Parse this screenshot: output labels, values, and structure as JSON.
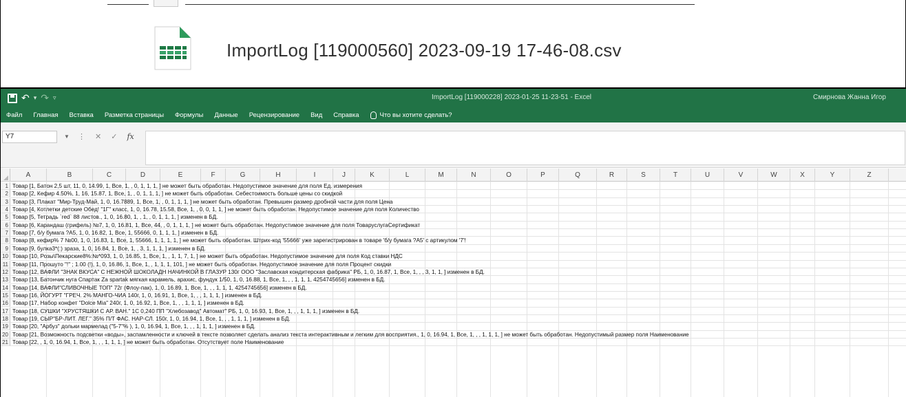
{
  "file_preview": {
    "file_name": "ImportLog [119000560] 2023-09-19 17-46-08.csv"
  },
  "excel": {
    "window_title": "ImportLog [119000228] 2023-01-25 11-23-51  -  Excel",
    "user_name": "Смирнова Жанна Игор",
    "ribbon_tabs": [
      "Файл",
      "Главная",
      "Вставка",
      "Разметка страницы",
      "Формулы",
      "Данные",
      "Рецензирование",
      "Вид",
      "Справка"
    ],
    "tell_me": "Что вы хотите сделать?",
    "name_box": "Y7",
    "formula_value": "",
    "columns": [
      "A",
      "B",
      "C",
      "D",
      "E",
      "F",
      "G",
      "H",
      "I",
      "J",
      "K",
      "L",
      "M",
      "N",
      "O",
      "P",
      "Q",
      "R",
      "S",
      "T",
      "U",
      "V",
      "W",
      "X",
      "Y",
      "Z"
    ],
    "rows": [
      {
        "n": "1",
        "text": "Товар [1, Батон 2,5 шт, 11, 0, 14.99, 1, Все, 1, , 0, 1, 1, 1, ] не может быть обработан. Недопустимое значение для поля Ед. измерения"
      },
      {
        "n": "2",
        "text": "Товар [2, Кефир 4.50%, 1, 16, 15.87, 1, Все, 1, , 0, 1, 1, 1, ] не может быть обработан. Себестоимость больше цены со скидкой"
      },
      {
        "n": "3",
        "text": "Товар [3, Плакат \"Мир-Труд-Май, 1, 0, 16.7889, 1, Все, 1, , 0, 1, 1, 1, ] не может быть обработан. Превышен размер дробной части для поля Цена"
      },
      {
        "n": "4",
        "text": "Товар [4, Котлетки детские Обед! \"1Г\" класс, 1, 0, 16.78, 15.58, Все, 1, , 0, 0, 1, 1, ] не может быть обработан. Недопустимое значение для поля Количество"
      },
      {
        "n": "5",
        "text": "Товар [5, Тетрадь `red` 88 листов., 1, 0, 16.80, 1, , 1, , 0, 1, 1, 1, ] изменен в БД."
      },
      {
        "n": "6",
        "text": "Товар [6, Карандаш (грифель) №7, 1, 0, 16.81, 1, Все, 44, , 0, 1, 1, 1, ] не может быть обработан. Недопустимое значение для поля ТоваруслугаСертификат"
      },
      {
        "n": "7",
        "text": "Товар [7, б/у бумага ?А5, 1, 0, 16.82, 1, Все, 1, 55666, 0, 1, 1, 1, ] изменен в БД."
      },
      {
        "n": "8",
        "text": "Товар [8, кефир% 7 №00, 1, 0, 16.83, 1, Все, 1, 55666, 1, 1, 1, 1, ] не может быть обработан. Штрих-код '55666' уже зарегистрирован в товаре 'б/у бумага ?А5' с артикулом '7'!"
      },
      {
        "n": "9",
        "text": "Товар [9, булка3*(:) зраза, 1, 0, 16.84, 1, Все, 1, , 3, 1, 1, 1, ] изменен в БД."
      },
      {
        "n": "10",
        "text": "Товар [10, Розы\\Пекарские8%:№*093, 1, 0, 16.85, 1, Все, 1, , 1, 1, 7, 1, ] не может быть обработан. Недопустимое значение для поля Код ставки НДС"
      },
      {
        "n": "11",
        "text": "Товар [11, Прошуто \"!\" ; 1.00 (!), 1, 0, 16.86, 1, Все, 1, , 1, 1, 1, 101, ] не может быть обработан. Недопустимое значение для поля Процент скидки"
      },
      {
        "n": "12",
        "text": "Товар [12, ВАФЛИ \"ЗНАК ВКУСА\" С НЕЖНОЙ ШОКОЛАДН НАЧИНКОЙ В ГЛАЗУР 130г ООО \"Заславская кондитерская фабрика\" РБ, 1, 0, 16.87, 1, Все, 1, , , 3, 1, 1, ] изменен в БД."
      },
      {
        "n": "13",
        "text": "Товар [13, Батончик нуга Спартак Za spartak мягкая карамель, арахис, фундук 1/50, 1, 0, 16.88, 1, Все, 1, , , 1, 1, 1, 4254745656] изменен в БД."
      },
      {
        "n": "14",
        "text": "Товар [14, ВАФЛИ\"СЛИВОЧНЫЕ ТОП\" 72г (Флоу-пак), 1, 0, 16.89, 1, Все, 1, , , 1, 1, 1, 4254745656] изменен в БД."
      },
      {
        "n": "15",
        "text": "Товар [16, ЙОГУРТ \"ГРЕЧ. 2% МАНГО-ЧИА 140г, 1, 0, 16.91, 1, Все, 1, , , 1, 1, 1, ] изменен в БД."
      },
      {
        "n": "16",
        "text": "Товар [17, Набор конфет \"Dolce Mia\" 240г, 1, 0, 16.92, 1, Все, 1, , , 1, 1, 1, ] изменен в БД."
      },
      {
        "n": "17",
        "text": "Товар [18, СУШКИ \"ХРУСТЯШКИ С АР. ВАН.\" 1С 0,240 ПП \"Хлебозавод\" Автомат\" РБ, 1, 0, 16.93, 1, Все, 1, , , 1, 1, 1, ] изменен в БД."
      },
      {
        "n": "18",
        "text": "Товар [19, СЫР\"БР-ЛИТ. ЛЕГ.\" 35% П/Т ФАС. НАР-СЛ. 150г, 1, 0, 16.94, 1, Все, 1, , , 1, 1, 1, ] изменен в БД."
      },
      {
        "n": "19",
        "text": "Товар [20, \"Арбуз\" дольки мармелад (\"5-7\"% ), 1, 0, 16.94, 1, Все, 1, , , 1, 1, 1, ] изменен в БД."
      },
      {
        "n": "20",
        "text": "Товар [21, Возможность подсветки «воды», заспамленности и ключей в тексте позволяет сделать анализ текста интерактивным и легким для восприятия., 1, 0, 16.94, 1, Все, 1, , , 1, 1, 1, ] не может быть обработан. Недопустимый размер поля Наименование"
      },
      {
        "n": "21",
        "text": "Товар [22, , 1, 0, 16.94, 1, Все, 1, , , 1, 1, 1, ] не может быть обработан. Отсутствует поле Наименование"
      }
    ]
  },
  "colors": {
    "excel_green": "#217346",
    "csv_icon_green": "#1e7a45"
  }
}
